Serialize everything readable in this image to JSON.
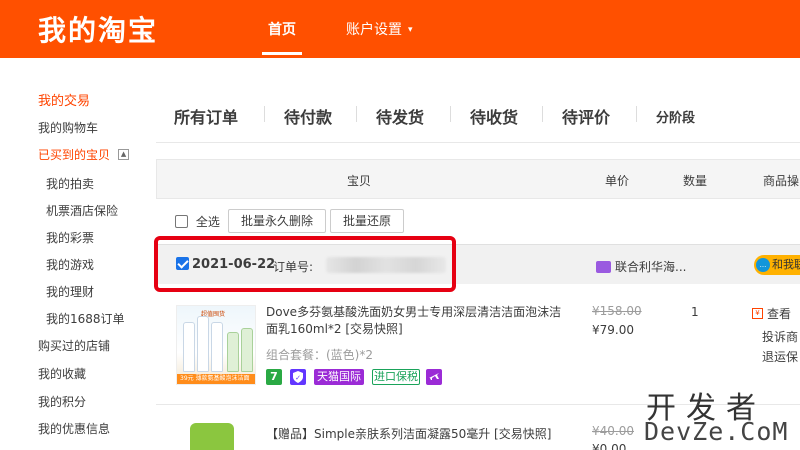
{
  "header": {
    "brand": "我的淘宝",
    "nav_home": "首页",
    "nav_account": "账户设置",
    "caret": "▾",
    "accent_color": "#ff5000"
  },
  "sidebar": {
    "items": [
      {
        "label": "我的交易",
        "active": true
      },
      {
        "label": "我的购物车"
      },
      {
        "label": "已买到的宝贝",
        "active": true,
        "collapse": "▲"
      },
      {
        "label": "我的拍卖"
      },
      {
        "label": "机票酒店保险"
      },
      {
        "label": "我的彩票"
      },
      {
        "label": "我的游戏"
      },
      {
        "label": "我的理财"
      },
      {
        "label": "我的1688订单"
      },
      {
        "label": "购买过的店铺"
      },
      {
        "label": "我的收藏"
      },
      {
        "label": "我的积分"
      },
      {
        "label": "我的优惠信息"
      }
    ]
  },
  "tabs": [
    "所有订单",
    "待付款",
    "待发货",
    "待收货",
    "待评价",
    "分阶段"
  ],
  "table_header": {
    "item": "宝贝",
    "unit_price": "单价",
    "quantity": "数量",
    "actions": "商品操"
  },
  "batch": {
    "select_all": "全选",
    "delete_forever": "批量永久删除",
    "restore": "批量还原"
  },
  "order": {
    "date": "2021-06-22",
    "order_no_label": "订单号:",
    "shop": "联合利华海...",
    "contact": "和我联",
    "contact_icon": "...",
    "highlight_color": "#e60012"
  },
  "products": [
    {
      "title": "Dove多芬氨基酸洗面奶女男士专用深层清洁洁面泡沫洁面乳160ml*2 [交易快照]",
      "spec": "组合套餐：(蓝色)*2",
      "orig_price": "¥158.00",
      "price": "¥79.00",
      "qty": "1",
      "image_banner": "39元 薄款氨基酸泡沫洁面",
      "image_tag": "超值囤货",
      "badges": [
        {
          "icon": "7",
          "color": "#2aa944"
        },
        {
          "icon": "shield-icon",
          "color": "#6236ff"
        },
        {
          "label": "天猫国际",
          "color": "#9b2bd6"
        },
        {
          "label": "进口保税",
          "color": "#1aa35a"
        },
        {
          "icon": "plane-icon",
          "color": "#9b2bd6"
        }
      ],
      "ops": [
        "查看",
        "投诉商",
        "退运保"
      ],
      "op_icon": "¥"
    },
    {
      "title": "【赠品】Simple亲肤系列洁面凝露50毫升 [交易快照]",
      "orig_price": "¥40.00",
      "price": "¥0.00"
    }
  ],
  "watermark": {
    "top": "开发者",
    "bottom": "DevZe.CoM"
  }
}
